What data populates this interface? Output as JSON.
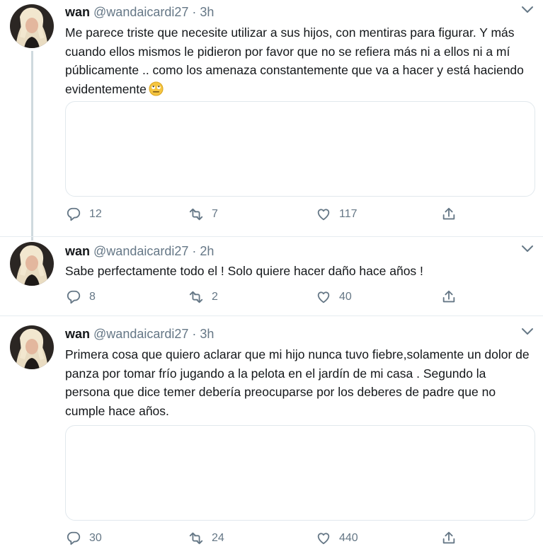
{
  "tweets": [
    {
      "name": "wan",
      "handle": "@wandaicardi27",
      "time": "· 3h",
      "text": "Me parece triste que necesite utilizar a sus hijos, con mentiras para figurar. Y más cuando ellos mismos le pidieron por favor que no se refiera más ni a ellos ni a mí públicamente .. como los amenaza constantemente que va a hacer y está haciendo evidentemente",
      "emoji": "rolling-eyes-emoji",
      "has_media_card": true,
      "replies": "12",
      "retweets": "7",
      "likes": "117"
    },
    {
      "name": "wan",
      "handle": "@wandaicardi27",
      "time": "· 2h",
      "text": "Sabe perfectamente todo el ! Solo quiere hacer daño hace años !",
      "has_media_card": false,
      "replies": "8",
      "retweets": "2",
      "likes": "40"
    },
    {
      "name": "wan",
      "handle": "@wandaicardi27",
      "time": "· 3h",
      "text": "Primera cosa que quiero aclarar que mi hijo nunca tuvo fiebre,solamente un dolor de panza por tomar frío jugando a la pelota en el jardín de mi casa . Segundo la persona que dice temer debería preocuparse por los deberes de padre que no cumple hace años.",
      "has_media_card": true,
      "replies": "30",
      "retweets": "24",
      "likes": "440"
    }
  ],
  "icons": {
    "reply": "reply-icon",
    "retweet": "retweet-icon",
    "like": "heart-icon",
    "share": "share-icon",
    "menu": "chevron-down-icon"
  },
  "colors": {
    "text": "#14171a",
    "secondary": "#657786",
    "divider": "#e6ecf0",
    "thread_line": "#cfd9de"
  }
}
